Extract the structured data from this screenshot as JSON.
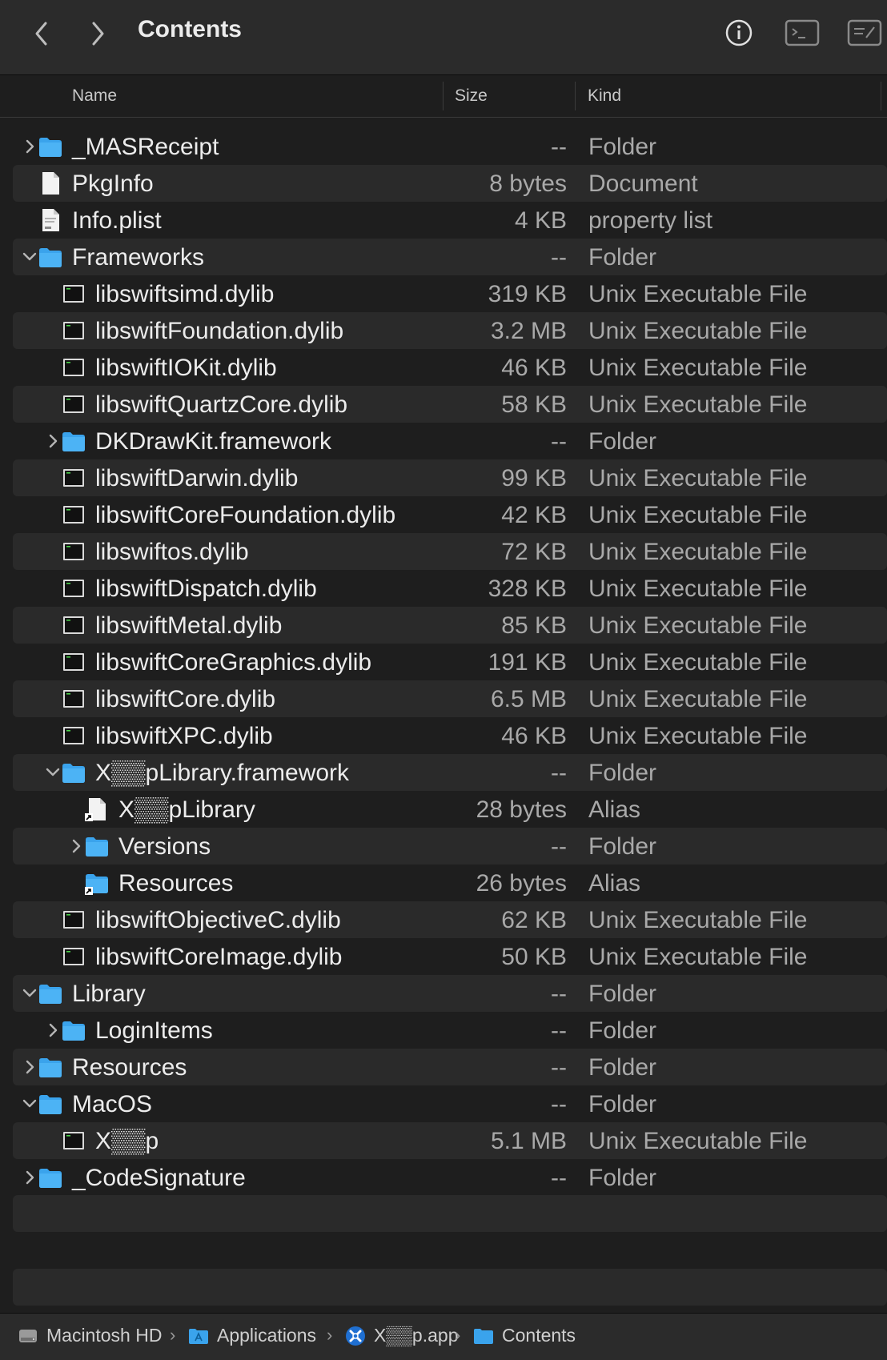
{
  "window": {
    "title": "Contents"
  },
  "columns": {
    "name": "Name",
    "size": "Size",
    "kind": "Kind"
  },
  "rows": [
    {
      "name": "_MASReceipt",
      "size": "--",
      "kind": "Folder",
      "level": 0,
      "icon": "folder-icon",
      "disclosure": "collapsed"
    },
    {
      "name": "PkgInfo",
      "size": "8 bytes",
      "kind": "Document",
      "level": 0,
      "icon": "document-icon",
      "disclosure": "none"
    },
    {
      "name": "Info.plist",
      "size": "4 KB",
      "kind": "property list",
      "level": 0,
      "icon": "plist-icon",
      "disclosure": "none"
    },
    {
      "name": "Frameworks",
      "size": "--",
      "kind": "Folder",
      "level": 0,
      "icon": "folder-icon",
      "disclosure": "expanded"
    },
    {
      "name": "libswiftsimd.dylib",
      "size": "319 KB",
      "kind": "Unix Executable File",
      "level": 1,
      "icon": "exec-icon",
      "disclosure": "none"
    },
    {
      "name": "libswiftFoundation.dylib",
      "size": "3.2 MB",
      "kind": "Unix Executable File",
      "level": 1,
      "icon": "exec-icon",
      "disclosure": "none"
    },
    {
      "name": "libswiftIOKit.dylib",
      "size": "46 KB",
      "kind": "Unix Executable File",
      "level": 1,
      "icon": "exec-icon",
      "disclosure": "none"
    },
    {
      "name": "libswiftQuartzCore.dylib",
      "size": "58 KB",
      "kind": "Unix Executable File",
      "level": 1,
      "icon": "exec-icon",
      "disclosure": "none"
    },
    {
      "name": "DKDrawKit.framework",
      "size": "--",
      "kind": "Folder",
      "level": 1,
      "icon": "folder-icon",
      "disclosure": "collapsed"
    },
    {
      "name": "libswiftDarwin.dylib",
      "size": "99 KB",
      "kind": "Unix Executable File",
      "level": 1,
      "icon": "exec-icon",
      "disclosure": "none"
    },
    {
      "name": "libswiftCoreFoundation.dylib",
      "size": "42 KB",
      "kind": "Unix Executable File",
      "level": 1,
      "icon": "exec-icon",
      "disclosure": "none"
    },
    {
      "name": "libswiftos.dylib",
      "size": "72 KB",
      "kind": "Unix Executable File",
      "level": 1,
      "icon": "exec-icon",
      "disclosure": "none"
    },
    {
      "name": "libswiftDispatch.dylib",
      "size": "328 KB",
      "kind": "Unix Executable File",
      "level": 1,
      "icon": "exec-icon",
      "disclosure": "none"
    },
    {
      "name": "libswiftMetal.dylib",
      "size": "85 KB",
      "kind": "Unix Executable File",
      "level": 1,
      "icon": "exec-icon",
      "disclosure": "none"
    },
    {
      "name": "libswiftCoreGraphics.dylib",
      "size": "191 KB",
      "kind": "Unix Executable File",
      "level": 1,
      "icon": "exec-icon",
      "disclosure": "none"
    },
    {
      "name": "libswiftCore.dylib",
      "size": "6.5 MB",
      "kind": "Unix Executable File",
      "level": 1,
      "icon": "exec-icon",
      "disclosure": "none"
    },
    {
      "name": "libswiftXPC.dylib",
      "size": "46 KB",
      "kind": "Unix Executable File",
      "level": 1,
      "icon": "exec-icon",
      "disclosure": "none"
    },
    {
      "name": "X▒▒pLibrary.framework",
      "size": "--",
      "kind": "Folder",
      "level": 1,
      "icon": "folder-icon",
      "disclosure": "expanded"
    },
    {
      "name": "X▒▒pLibrary",
      "size": "28 bytes",
      "kind": "Alias",
      "level": 2,
      "icon": "alias-document-icon",
      "disclosure": "none"
    },
    {
      "name": "Versions",
      "size": "--",
      "kind": "Folder",
      "level": 2,
      "icon": "folder-icon",
      "disclosure": "collapsed"
    },
    {
      "name": "Resources",
      "size": "26 bytes",
      "kind": "Alias",
      "level": 2,
      "icon": "alias-folder-icon",
      "disclosure": "none"
    },
    {
      "name": "libswiftObjectiveC.dylib",
      "size": "62 KB",
      "kind": "Unix Executable File",
      "level": 1,
      "icon": "exec-icon",
      "disclosure": "none"
    },
    {
      "name": "libswiftCoreImage.dylib",
      "size": "50 KB",
      "kind": "Unix Executable File",
      "level": 1,
      "icon": "exec-icon",
      "disclosure": "none"
    },
    {
      "name": "Library",
      "size": "--",
      "kind": "Folder",
      "level": 0,
      "icon": "folder-icon",
      "disclosure": "expanded"
    },
    {
      "name": "LoginItems",
      "size": "--",
      "kind": "Folder",
      "level": 1,
      "icon": "folder-icon",
      "disclosure": "collapsed"
    },
    {
      "name": "Resources",
      "size": "--",
      "kind": "Folder",
      "level": 0,
      "icon": "folder-icon",
      "disclosure": "collapsed"
    },
    {
      "name": "MacOS",
      "size": "--",
      "kind": "Folder",
      "level": 0,
      "icon": "folder-icon",
      "disclosure": "expanded"
    },
    {
      "name": "X▒▒p",
      "size": "5.1 MB",
      "kind": "Unix Executable File",
      "level": 1,
      "icon": "exec-icon",
      "disclosure": "none"
    },
    {
      "name": "_CodeSignature",
      "size": "--",
      "kind": "Folder",
      "level": 0,
      "icon": "folder-icon",
      "disclosure": "collapsed"
    }
  ],
  "pathbar": [
    {
      "label": "Macintosh HD",
      "icon": "hard-drive-icon"
    },
    {
      "label": "Applications",
      "icon": "applications-folder-icon"
    },
    {
      "label": "X▒▒p.app",
      "icon": "app-icon"
    },
    {
      "label": "Contents",
      "icon": "folder-icon"
    }
  ],
  "colors": {
    "folder": "#3aa3ec",
    "background": "#1e1e1e",
    "stripe": "#2a2a2a"
  }
}
